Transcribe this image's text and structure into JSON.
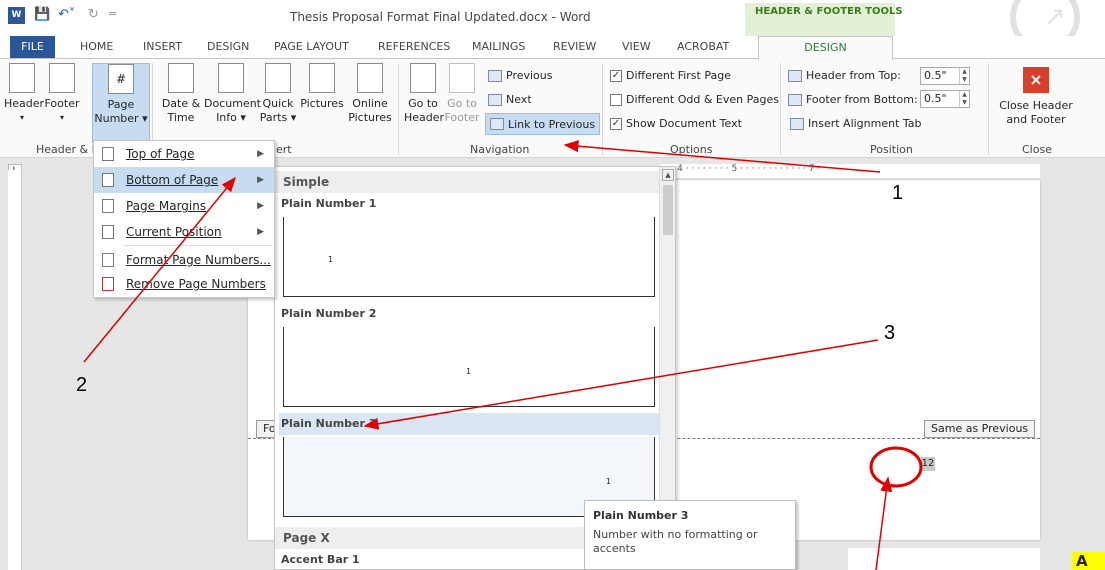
{
  "window": {
    "title": "Thesis Proposal Format Final Updated.docx - Word",
    "context_tab_group": "HEADER & FOOTER TOOLS"
  },
  "tabs": [
    "FILE",
    "HOME",
    "INSERT",
    "DESIGN",
    "PAGE LAYOUT",
    "REFERENCES",
    "MAILINGS",
    "REVIEW",
    "VIEW",
    "ACROBAT"
  ],
  "active_tab": "DESIGN",
  "ribbon": {
    "header_footer_group": {
      "header": "Header",
      "footer": "Footer",
      "page_label_1": "Page",
      "page_label_2": "Number",
      "group_label": "Header & F"
    },
    "insert_group": {
      "date_time_1": "Date &",
      "date_time_2": "Time",
      "doc_info_1": "Document",
      "doc_info_2": "Info",
      "quick_parts_1": "Quick",
      "quick_parts_2": "Parts",
      "pictures": "Pictures",
      "online_1": "Online",
      "online_2": "Pictures",
      "group_label_tail": "ert"
    },
    "navigation_group": {
      "goto_header_1": "Go to",
      "goto_header_2": "Header",
      "goto_footer_1": "Go to",
      "goto_footer_2": "Footer",
      "previous": "Previous",
      "next": "Next",
      "link_to_previous": "Link to Previous",
      "group_label": "Navigation"
    },
    "options_group": {
      "different_first_page": "Different First Page",
      "different_odd_even": "Different Odd & Even Pages",
      "show_document_text": "Show Document Text",
      "group_label": "Options"
    },
    "position_group": {
      "header_from_top": "Header from Top:",
      "header_from_top_value": "0.5\"",
      "footer_from_bottom": "Footer from Bottom:",
      "footer_from_bottom_value": "0.5\"",
      "insert_alignment_tab": "Insert Alignment Tab",
      "group_label": "Position"
    },
    "close_group": {
      "close_1": "Close Header",
      "close_2": "and Footer",
      "group_label": "Close"
    }
  },
  "page_number_menu": {
    "items": [
      {
        "label": "Top of Page",
        "icon": "page-top-icon",
        "submenu": true
      },
      {
        "label": "Bottom of Page",
        "icon": "page-bottom-icon",
        "submenu": true
      },
      {
        "label": "Page Margins",
        "icon": "page-margins-icon",
        "submenu": true
      },
      {
        "label": "Current Position",
        "icon": "current-position-icon",
        "submenu": true
      },
      {
        "label": "Format Page Numbers...",
        "icon": "format-page-numbers-icon",
        "submenu": false
      },
      {
        "label": "Remove Page Numbers",
        "icon": "remove-page-numbers-icon",
        "submenu": false
      }
    ]
  },
  "gallery": {
    "section_simple": "Simple",
    "items": [
      "Plain Number 1",
      "Plain Number 2",
      "Plain Number 3"
    ],
    "thumb_number": "1",
    "section_page_x": "Page X",
    "accent_bar": "Accent Bar 1"
  },
  "tooltip": {
    "title": "Plain Number 3",
    "description": "Number with no formatting or accents"
  },
  "document": {
    "footer_tag_left": "Fo",
    "same_as_previous": "Same as Previous",
    "page_number": "12",
    "highlight_text": "A"
  },
  "ruler": {
    "marks": "· · · 4 · · · · · · · · 5 · · · · · · · · · · · · 7 ·"
  },
  "annotations": {
    "labels": [
      "1",
      "2",
      "3"
    ],
    "arrow_color": "#e00000"
  }
}
